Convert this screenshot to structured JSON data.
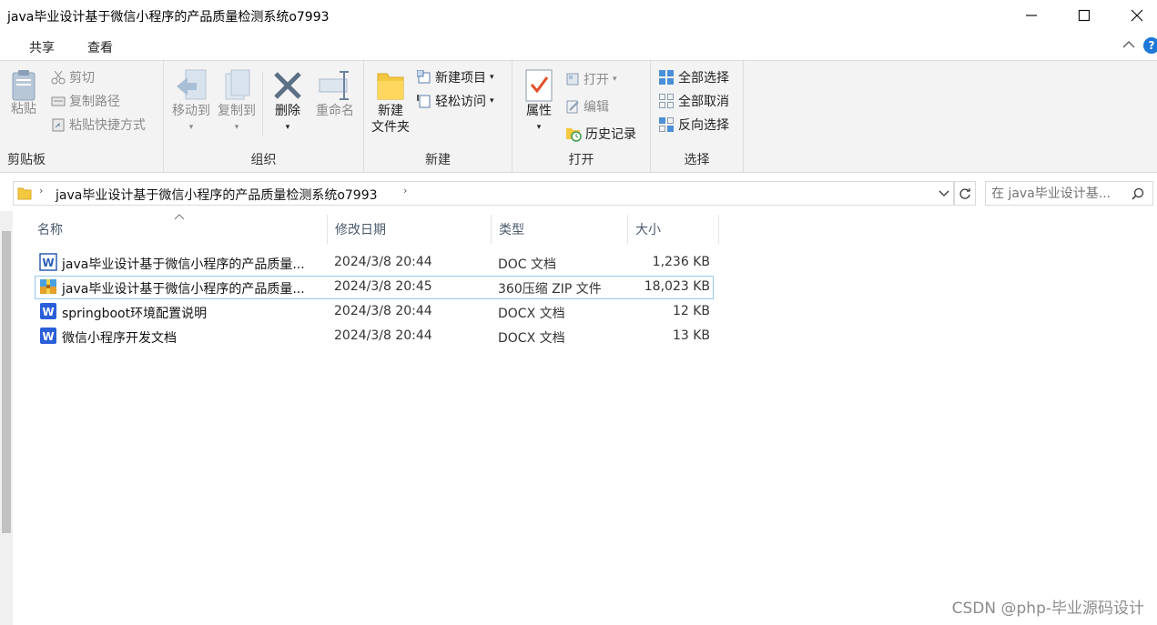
{
  "window": {
    "title": "java毕业设计基于微信小程序的产品质量检测系统o7993"
  },
  "menu_tabs": [
    {
      "label": "共享"
    },
    {
      "label": "查看"
    }
  ],
  "ribbon": {
    "clipboard": {
      "label": "剪贴板",
      "paste": "粘贴",
      "cut": "剪切",
      "copy_path": "复制路径",
      "paste_shortcut": "粘贴快捷方式"
    },
    "organize": {
      "label": "组织",
      "move_to": "移动到",
      "copy_to": "复制到",
      "delete": "删除",
      "rename": "重命名"
    },
    "new": {
      "label": "新建",
      "new_folder_l1": "新建",
      "new_folder_l2": "文件夹",
      "new_item": "新建项目",
      "easy_access": "轻松访问"
    },
    "open": {
      "label": "打开",
      "properties": "属性",
      "open": "打开",
      "edit": "编辑",
      "history": "历史记录"
    },
    "select": {
      "label": "选择",
      "select_all": "全部选择",
      "select_none": "全部取消",
      "invert": "反向选择"
    }
  },
  "address": {
    "path": "java毕业设计基于微信小程序的产品质量检测系统o7993",
    "search_placeholder": "在 java毕业设计基..."
  },
  "columns": {
    "name": "名称",
    "modified": "修改日期",
    "type": "类型",
    "size": "大小"
  },
  "files": [
    {
      "name": "java毕业设计基于微信小程序的产品质量...",
      "modified": "2024/3/8 20:44",
      "type": "DOC 文档",
      "size": "1,236 KB",
      "icon": "word-doc-icon"
    },
    {
      "name": "java毕业设计基于微信小程序的产品质量...",
      "modified": "2024/3/8 20:45",
      "type": "360压缩 ZIP 文件",
      "size": "18,023 KB",
      "icon": "zip-archive-icon"
    },
    {
      "name": "springboot环境配置说明",
      "modified": "2024/3/8 20:44",
      "type": "DOCX 文档",
      "size": "12 KB",
      "icon": "word-docx-icon"
    },
    {
      "name": "微信小程序开发文档",
      "modified": "2024/3/8 20:44",
      "type": "DOCX 文档",
      "size": "13 KB",
      "icon": "word-docx-icon"
    }
  ],
  "watermark": "CSDN @php-毕业源码设计",
  "colors": {
    "accent": "#1e78d7",
    "selection_border": "#99c9ef",
    "ribbon_bg": "#f3f3f3"
  }
}
